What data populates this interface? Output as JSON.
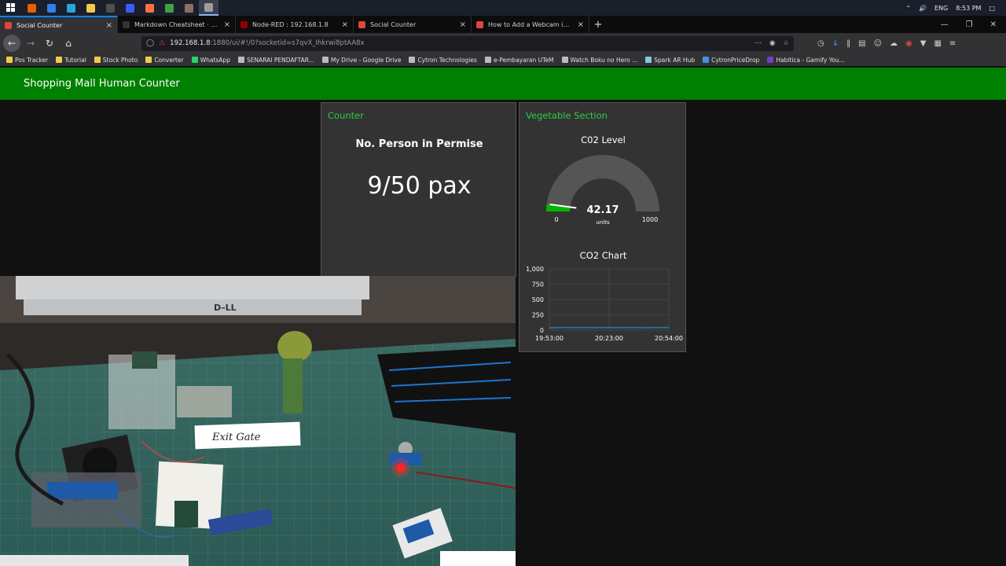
{
  "taskbar": {
    "apps": [
      {
        "name": "firefox",
        "color": "#e66000"
      },
      {
        "name": "vscode",
        "color": "#2f80ed"
      },
      {
        "name": "telegram",
        "color": "#2aa3df"
      },
      {
        "name": "explorer",
        "color": "#f2c94c"
      },
      {
        "name": "terminal",
        "color": "#4f4f4f"
      },
      {
        "name": "app6",
        "color": "#3d5afe"
      },
      {
        "name": "app7",
        "color": "#ff7043"
      },
      {
        "name": "app8",
        "color": "#43a047"
      },
      {
        "name": "app9",
        "color": "#8d6e63"
      },
      {
        "name": "app10",
        "color": "#9e9e9e"
      }
    ],
    "language": "ENG",
    "time": "8:53 PM"
  },
  "tabs": [
    {
      "label": "Social Counter",
      "active": true,
      "favicon": "#e0453b"
    },
    {
      "label": "Markdown Cheatsheet · adam-p/markdown-here",
      "active": false,
      "favicon": "#333333"
    },
    {
      "label": "Node-RED : 192.168.1.8",
      "active": false,
      "favicon": "#8f0000"
    },
    {
      "label": "Social Counter",
      "active": false,
      "favicon": "#e0453b"
    },
    {
      "label": "How to Add a Webcam in OBS",
      "active": false,
      "favicon": "#e0453b"
    }
  ],
  "url": {
    "host": "192.168.1.8",
    "path": ":1880/ui/#!/0?socketid=s7qvX_Ihkrwi8ptAA8x"
  },
  "bookmarks": [
    {
      "label": "Pos Tracker",
      "color": "#f2c94c"
    },
    {
      "label": "Tutorial",
      "color": "#f2c94c"
    },
    {
      "label": "Stock Photo",
      "color": "#f2c94c"
    },
    {
      "label": "Converter",
      "color": "#f2c94c"
    },
    {
      "label": "WhatsApp",
      "color": "#25d366"
    },
    {
      "label": "SENARAI PENDAFTAR...",
      "color": "#bbbbbb"
    },
    {
      "label": "My Drive - Google Drive",
      "color": "#bbbbbb"
    },
    {
      "label": "Cytron Technologies",
      "color": "#bbbbbb"
    },
    {
      "label": "e-Pembayaran UTeM",
      "color": "#bbbbbb"
    },
    {
      "label": "Watch Boku no Hero ...",
      "color": "#bbbbbb"
    },
    {
      "label": "Spark AR Hub",
      "color": "#7ec8e3"
    },
    {
      "label": "CytronPriceDrop",
      "color": "#4a90e2"
    },
    {
      "label": "Habitica - Gamify You...",
      "color": "#6f42c1"
    }
  ],
  "dashboard": {
    "title": "Shopping Mall Human Counter",
    "accent": "#008000"
  },
  "counter": {
    "group_title": "Counter",
    "heading": "No. Person in Permise",
    "value": "9/50 pax"
  },
  "vegetable": {
    "group_title": "Vegetable Section",
    "gauge": {
      "title": "C02 Level",
      "value": 42.17,
      "value_text": "42.17",
      "units": "units",
      "min": 0,
      "max": 1000,
      "min_label": "0",
      "max_label": "1000"
    },
    "chart": {
      "title": "CO2 Chart"
    }
  },
  "chart_data": {
    "type": "line",
    "title": "CO2 Chart",
    "xlabel": "",
    "ylabel": "",
    "x_ticks": [
      "19:53:00",
      "20:23:00",
      "20:54:00"
    ],
    "y_ticks": [
      "0",
      "250",
      "500",
      "750",
      "1,000"
    ],
    "ylim": [
      0,
      1000
    ],
    "grid": true,
    "series": [
      {
        "color": "#1f77b4",
        "values": [
          40,
          42,
          41,
          43,
          42,
          41,
          42,
          43,
          42,
          41,
          42,
          42,
          43,
          41,
          42,
          42,
          41,
          43,
          42,
          40,
          41,
          42,
          42,
          43,
          42
        ]
      }
    ]
  }
}
